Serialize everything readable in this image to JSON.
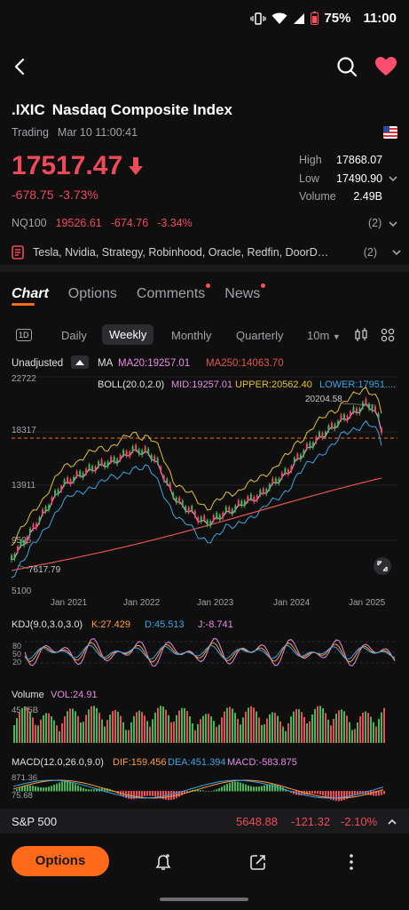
{
  "status_bar": {
    "battery": "75%",
    "time": "11:00"
  },
  "header": {
    "ticker": ".IXIC",
    "name": "Nasdaq Composite Index",
    "status": "Trading",
    "datetime": "Mar 10 11:00:41",
    "price": "17517.47",
    "change": "-678.75",
    "change_pct": "-3.73%",
    "high_label": "High",
    "high": "17868.07",
    "low_label": "Low",
    "low": "17490.90",
    "volume_label": "Volume",
    "volume": "2.49B"
  },
  "related": {
    "nq_label": "NQ100",
    "nq_price": "19526.61",
    "nq_change": "-674.76",
    "nq_pct": "-3.34%",
    "nq_count": "(2)",
    "news_text": "Tesla, Nvidia, Strategy, Robinhood, Oracle, Redfin, DoorDash: Bi...",
    "news_count": "(2)"
  },
  "tabs": [
    "Chart",
    "Options",
    "Comments",
    "News"
  ],
  "periods": {
    "day_icon": "1D",
    "items": [
      "Daily",
      "Weekly",
      "Monthly",
      "Quarterly",
      "10m"
    ],
    "selected": "Weekly"
  },
  "chart": {
    "adjust_label": "Unadjusted",
    "ma_label": "MA",
    "ma20": "MA20:19257.01",
    "ma250": "MA250:14063.70",
    "boll_label": "BOLL(20.0,2.0)",
    "boll_mid": "MID:19257.01",
    "boll_upper": "UPPER:20562.40",
    "boll_lower": "LOWER:17951....",
    "y_ticks": [
      "22722",
      "18317",
      "13911",
      "9506",
      "5100"
    ],
    "high_marker": "20204.58",
    "low_marker": "7617.79",
    "x_ticks": [
      "Jan 2021",
      "Jan 2022",
      "Jan 2023",
      "Jan 2024",
      "Jan 2025"
    ],
    "kdj_label": "KDJ(9.0,3.0,3.0)",
    "kdj_k": "K:27.429",
    "kdj_d": "D:45.513",
    "kdj_j": "J:-8.741",
    "kdj_ticks": [
      "80",
      "50",
      "20"
    ],
    "vol_label": "Volume",
    "vol_value": "VOL:24.91",
    "vol_max": "45.75B",
    "macd_label": "MACD(12.0,26.0,9.0)",
    "macd_dif": "DIF:159.456",
    "macd_dea": "DEA:451.394",
    "macd_val": "MACD:-583.875",
    "macd_ticks": [
      "871.36",
      "75.68"
    ]
  },
  "chart_data": {
    "type": "line",
    "x_labels": [
      "Jan 2021",
      "Jan 2022",
      "Jan 2023",
      "Jan 2024",
      "Jan 2025"
    ],
    "ylim": [
      5100,
      22722
    ],
    "annotations": {
      "high": 20204.58,
      "low": 7617.79,
      "last": 17517.47
    },
    "series": [
      {
        "name": "MA20",
        "last": 19257.01
      },
      {
        "name": "MA250",
        "last": 14063.7
      },
      {
        "name": "UPPER",
        "last": 20562.4
      },
      {
        "name": "LOWER",
        "last": 17951
      }
    ]
  },
  "index_bar": {
    "name": "S&P 500",
    "price": "5648.88",
    "change": "-121.32",
    "pct": "-2.10%"
  },
  "toolbar": {
    "options_label": "Options"
  },
  "colors": {
    "up": "#3fb950",
    "down": "#f0495a",
    "accent": "#ff6a1a",
    "boll_upper": "#e6c22d",
    "boll_lower": "#3aa7e6",
    "mid": "#e58de0",
    "ma250": "#e5544f"
  }
}
